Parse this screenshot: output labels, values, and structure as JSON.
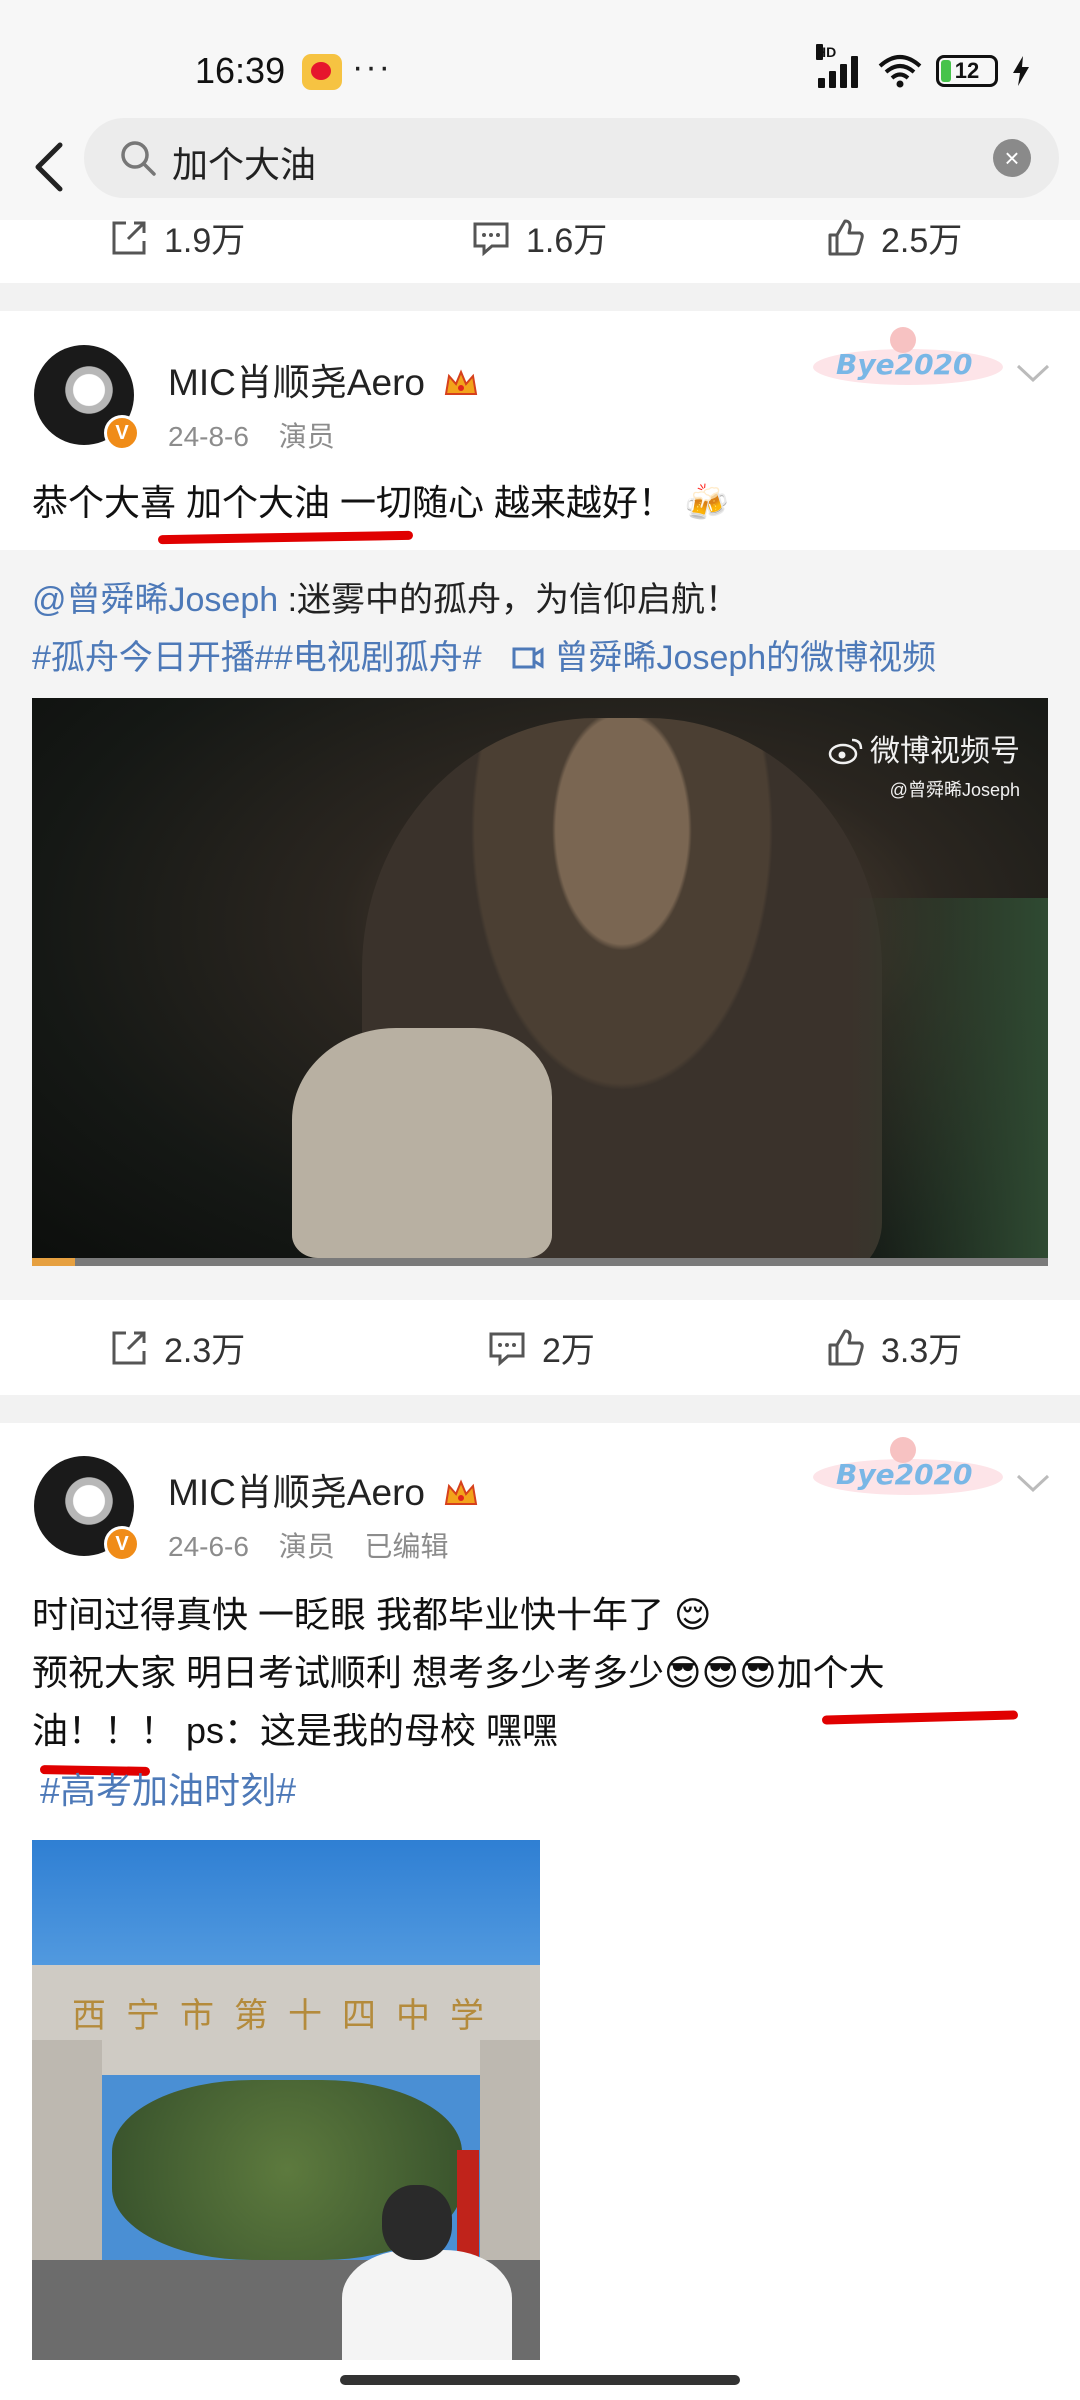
{
  "status": {
    "time": "16:39",
    "network": "HD",
    "battery": "12"
  },
  "search": {
    "query": "加个大油"
  },
  "top_actions": {
    "share": "1.9万",
    "comment": "1.6万",
    "like": "2.5万"
  },
  "post1": {
    "username": "MIC肖顺尧Aero",
    "date": "24-8-6",
    "source": "演员",
    "text": "恭个大喜 加个大油 一切随心 越来越好！",
    "emoji": "🍻",
    "repost": {
      "mention": "@曾舜晞Joseph",
      "text": " :迷雾中的孤舟，为信仰启航！",
      "tags": "#孤舟今日开播##电视剧孤舟#",
      "video_link": "曾舜晞Joseph的微博视频",
      "watermark_title": "微博视频号",
      "watermark_user": "@曾舜晞Joseph",
      "progress": 0.042
    },
    "actions": {
      "share": "2.3万",
      "comment": "2万",
      "like": "3.3万"
    }
  },
  "post2": {
    "username": "MIC肖顺尧Aero",
    "date": "24-6-6",
    "source": "演员",
    "edited": "已编辑",
    "line1": "时间过得真快 一眨眼 我都毕业快十年了 ",
    "line1_emoji": "😌",
    "line2": "预祝大家 明日考试顺利 想考多少考多少",
    "line2_emoji": "😎😎😎",
    "line2_tail": "加个大",
    "line3": "油！！！ ps：这是我的母校 嘿嘿",
    "tag": "#高考加油时刻#",
    "photo_sign": "西宁市第十四中学"
  },
  "icons": [
    "back-icon",
    "search-icon",
    "clear-icon",
    "share-icon",
    "comment-icon",
    "like-icon",
    "crown-icon",
    "chevron-down-icon",
    "video-link-icon",
    "weibo-logo-icon"
  ],
  "colors": {
    "link": "#4d79b8",
    "underline": "#e00000",
    "badge": "#f08c18"
  }
}
